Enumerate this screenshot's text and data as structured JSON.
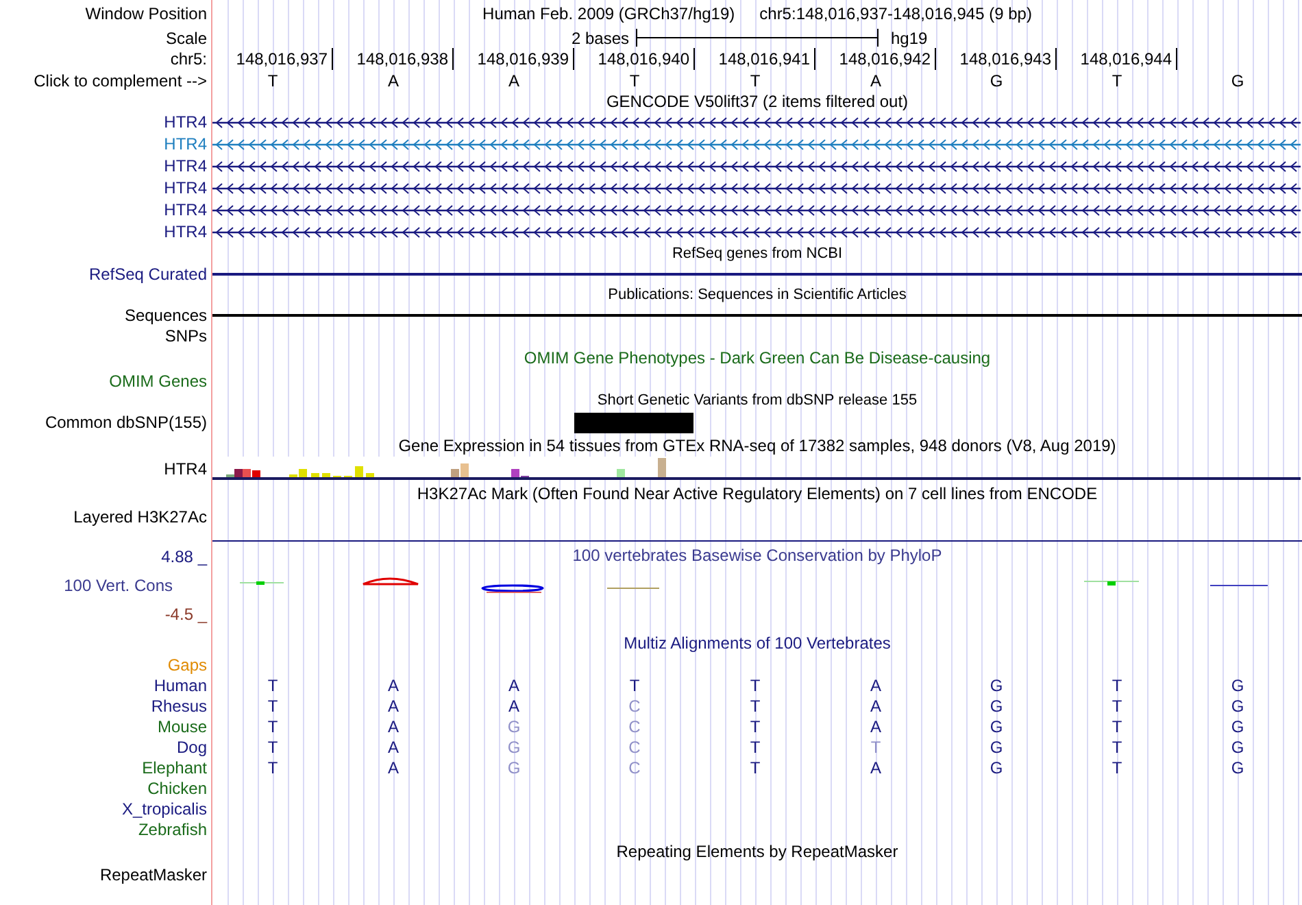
{
  "header": {
    "label": "Window Position",
    "assembly": "Human Feb. 2009 (GRCh37/hg19)",
    "position": "chr5:148,016,937-148,016,945 (9 bp)"
  },
  "scale": {
    "label": "Scale",
    "bar_text": "2 bases",
    "assembly": "hg19"
  },
  "ruler": {
    "label": "chr5:",
    "positions": [
      "148,016,937",
      "148,016,938",
      "148,016,939",
      "148,016,940",
      "148,016,941",
      "148,016,942",
      "148,016,943",
      "148,016,944"
    ]
  },
  "complement": {
    "label": "Click to complement -->",
    "bases": [
      "T",
      "A",
      "A",
      "T",
      "T",
      "A",
      "G",
      "T",
      "G"
    ]
  },
  "tracks": [
    {
      "kind": "genes",
      "title": "GENCODE V50lift37 (2 items filtered out)",
      "color": "#000000",
      "items": [
        {
          "label": "HTR4",
          "color": "#1a1a80"
        },
        {
          "label": "HTR4",
          "color": "#1f7fbf"
        },
        {
          "label": "HTR4",
          "color": "#1a1a80"
        },
        {
          "label": "HTR4",
          "color": "#1a1a80"
        },
        {
          "label": "HTR4",
          "color": "#1a1a80"
        },
        {
          "label": "HTR4",
          "color": "#1a1a80"
        }
      ]
    },
    {
      "kind": "line",
      "title": "RefSeq genes from NCBI",
      "label": "RefSeq Curated",
      "color": "#1a1a80"
    },
    {
      "kind": "line",
      "title": "Publications: Sequences in Scientific Articles",
      "label": "Sequences",
      "color": "#000000"
    },
    {
      "kind": "empty",
      "label": "SNPs",
      "color": "#000000"
    },
    {
      "kind": "empty",
      "title": "OMIM Gene Phenotypes - Dark Green Can Be Disease-causing",
      "label": "OMIM Genes",
      "color": "#1a6b1a"
    },
    {
      "kind": "snp",
      "title": "Short Genetic Variants from dbSNP release 155",
      "label": "Common dbSNP(155)",
      "color": "#000000"
    },
    {
      "kind": "expression",
      "title": "Gene Expression in 54 tissues from GTEx RNA-seq of 17382 samples, 948 donors (V8, Aug 2019)",
      "label": "HTR4",
      "color": "#000000"
    },
    {
      "kind": "empty",
      "title": "H3K27Ac Mark (Often Found Near Active Regulatory Elements) on 7 cell lines from ENCODE",
      "label": "Layered H3K27Ac",
      "color": "#000000"
    },
    {
      "kind": "conservation",
      "title": "100 vertebrates Basewise Conservation by PhyloP",
      "label": "100 Vert. Cons",
      "max": "4.88 _",
      "min": "-4.5 _",
      "color": "#3a3a8f"
    },
    {
      "kind": "alignment",
      "title": "Multiz Alignments of 100 Vertebrates",
      "label": "Gaps",
      "color": "#e08a00",
      "species": [
        {
          "name": "Human",
          "color": "#1a1a80",
          "bases": [
            {
              "base": "T",
              "mismatch": false
            },
            {
              "base": "A",
              "mismatch": false
            },
            {
              "base": "A",
              "mismatch": false
            },
            {
              "base": "T",
              "mismatch": false
            },
            {
              "base": "T",
              "mismatch": false
            },
            {
              "base": "A",
              "mismatch": false
            },
            {
              "base": "G",
              "mismatch": false
            },
            {
              "base": "T",
              "mismatch": false
            },
            {
              "base": "G",
              "mismatch": false
            }
          ]
        },
        {
          "name": "Rhesus",
          "color": "#1a1a80",
          "bases": [
            {
              "base": "T",
              "mismatch": false
            },
            {
              "base": "A",
              "mismatch": false
            },
            {
              "base": "A",
              "mismatch": false
            },
            {
              "base": "C",
              "mismatch": true
            },
            {
              "base": "T",
              "mismatch": false
            },
            {
              "base": "A",
              "mismatch": false
            },
            {
              "base": "G",
              "mismatch": false
            },
            {
              "base": "T",
              "mismatch": false
            },
            {
              "base": "G",
              "mismatch": false
            }
          ]
        },
        {
          "name": "Mouse",
          "color": "#1a6b1a",
          "bases": [
            {
              "base": "T",
              "mismatch": false
            },
            {
              "base": "A",
              "mismatch": false
            },
            {
              "base": "G",
              "mismatch": true
            },
            {
              "base": "C",
              "mismatch": true
            },
            {
              "base": "T",
              "mismatch": false
            },
            {
              "base": "A",
              "mismatch": false
            },
            {
              "base": "G",
              "mismatch": false
            },
            {
              "base": "T",
              "mismatch": false
            },
            {
              "base": "G",
              "mismatch": false
            }
          ]
        },
        {
          "name": "Dog",
          "color": "#1a1a80",
          "bases": [
            {
              "base": "T",
              "mismatch": false
            },
            {
              "base": "A",
              "mismatch": false
            },
            {
              "base": "G",
              "mismatch": true
            },
            {
              "base": "C",
              "mismatch": true
            },
            {
              "base": "T",
              "mismatch": false
            },
            {
              "base": "T",
              "mismatch": true
            },
            {
              "base": "G",
              "mismatch": false
            },
            {
              "base": "T",
              "mismatch": false
            },
            {
              "base": "G",
              "mismatch": false
            }
          ]
        },
        {
          "name": "Elephant",
          "color": "#1a6b1a",
          "bases": [
            {
              "base": "T",
              "mismatch": false
            },
            {
              "base": "A",
              "mismatch": false
            },
            {
              "base": "G",
              "mismatch": true
            },
            {
              "base": "C",
              "mismatch": true
            },
            {
              "base": "T",
              "mismatch": false
            },
            {
              "base": "A",
              "mismatch": false
            },
            {
              "base": "G",
              "mismatch": false
            },
            {
              "base": "T",
              "mismatch": false
            },
            {
              "base": "G",
              "mismatch": false
            }
          ]
        },
        {
          "name": "Chicken",
          "color": "#1a6b1a"
        },
        {
          "name": "X_tropicalis",
          "color": "#1a1a80"
        },
        {
          "name": "Zebrafish",
          "color": "#1a6b1a"
        }
      ]
    },
    {
      "kind": "empty",
      "title": "Repeating Elements by RepeatMasker",
      "label": "RepeatMasker",
      "color": "#000000"
    }
  ]
}
